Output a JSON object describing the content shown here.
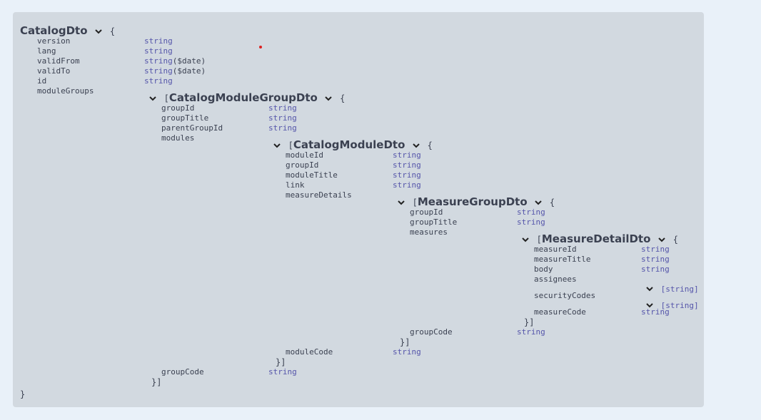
{
  "root": {
    "title": "CatalogDto",
    "open": "{",
    "close": "}",
    "props": [
      {
        "name": "version",
        "type": "string"
      },
      {
        "name": "lang",
        "type": "string"
      },
      {
        "name": "validFrom",
        "type": "string",
        "format": "($date)"
      },
      {
        "name": "validTo",
        "type": "string",
        "format": "($date)"
      },
      {
        "name": "id",
        "type": "string"
      },
      {
        "name": "moduleGroups"
      }
    ]
  },
  "moduleGroup": {
    "title": "CatalogModuleGroupDto",
    "open_bracket": "[",
    "open": "{",
    "close": "}]",
    "props": [
      {
        "name": "groupId",
        "type": "string"
      },
      {
        "name": "groupTitle",
        "type": "string"
      },
      {
        "name": "parentGroupId",
        "type": "string"
      },
      {
        "name": "modules"
      }
    ],
    "tail": {
      "name": "groupCode",
      "type": "string"
    }
  },
  "module": {
    "title": "CatalogModuleDto",
    "open_bracket": "[",
    "open": "{",
    "close": "}]",
    "props": [
      {
        "name": "moduleId",
        "type": "string"
      },
      {
        "name": "groupId",
        "type": "string"
      },
      {
        "name": "moduleTitle",
        "type": "string"
      },
      {
        "name": "link",
        "type": "string"
      },
      {
        "name": "measureDetails"
      }
    ],
    "tail": {
      "name": "moduleCode",
      "type": "string"
    }
  },
  "measureGroup": {
    "title": "MeasureGroupDto",
    "open_bracket": "[",
    "open": "{",
    "close": "}]",
    "props": [
      {
        "name": "groupId",
        "type": "string"
      },
      {
        "name": "groupTitle",
        "type": "string"
      },
      {
        "name": "measures"
      }
    ],
    "tail": {
      "name": "groupCode",
      "type": "string"
    }
  },
  "measureDetail": {
    "title": "MeasureDetailDto",
    "open_bracket": "[",
    "open": "{",
    "close": "}]",
    "props": [
      {
        "name": "measureId",
        "type": "string"
      },
      {
        "name": "measureTitle",
        "type": "string"
      },
      {
        "name": "body",
        "type": "string"
      },
      {
        "name": "assignees",
        "type": "[string]"
      },
      {
        "name": "securityCodes",
        "type": "[string]"
      },
      {
        "name": "measureCode",
        "type": "string"
      }
    ]
  }
}
